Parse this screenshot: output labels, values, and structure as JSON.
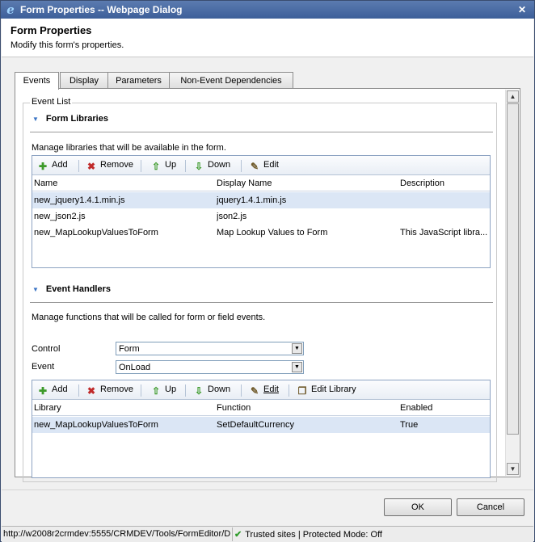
{
  "window": {
    "title": "Form Properties -- Webpage Dialog",
    "close_glyph": "✕"
  },
  "header": {
    "title": "Form Properties",
    "subtitle": "Modify this form's properties."
  },
  "tabs": [
    {
      "label": "Events",
      "active": true
    },
    {
      "label": "Display",
      "active": false
    },
    {
      "label": "Parameters",
      "active": false
    },
    {
      "label": "Non-Event Dependencies",
      "active": false
    }
  ],
  "event_list": {
    "legend": "Event List",
    "form_libraries": {
      "title": "Form Libraries",
      "description": "Manage libraries that will be available in the form.",
      "toolbar": {
        "add": "Add",
        "remove": "Remove",
        "up": "Up",
        "down": "Down",
        "edit": "Edit"
      },
      "columns": [
        "Name",
        "Display Name",
        "Description"
      ],
      "rows": [
        {
          "name": "new_jquery1.4.1.min.js",
          "display_name": "jquery1.4.1.min.js",
          "description": "",
          "selected": true
        },
        {
          "name": "new_json2.js",
          "display_name": "json2.js",
          "description": "",
          "selected": false
        },
        {
          "name": "new_MapLookupValuesToForm",
          "display_name": "Map Lookup Values to Form",
          "description": "This JavaScript libra...",
          "selected": false
        }
      ]
    },
    "event_handlers": {
      "title": "Event Handlers",
      "description": "Manage functions that will be called for form or field events.",
      "control_label": "Control",
      "control_value": "Form",
      "event_label": "Event",
      "event_value": "OnLoad",
      "toolbar": {
        "add": "Add",
        "remove": "Remove",
        "up": "Up",
        "down": "Down",
        "edit": "Edit",
        "edit_library": "Edit Library"
      },
      "columns": [
        "Library",
        "Function",
        "Enabled"
      ],
      "rows": [
        {
          "library": "new_MapLookupValuesToForm",
          "function": "SetDefaultCurrency",
          "enabled": "True",
          "selected": true
        }
      ]
    }
  },
  "footer": {
    "ok": "OK",
    "cancel": "Cancel"
  },
  "statusbar": {
    "url": "http://w2008r2crmdev:5555/CRMDEV/Tools/FormEditor/D",
    "zone": "Trusted sites | Protected Mode: Off"
  },
  "icons": {
    "ie": "internet-explorer-icon",
    "add": "add-icon",
    "remove": "remove-icon",
    "up": "up-arrow-icon",
    "down": "down-arrow-icon",
    "edit": "edit-icon",
    "edit_library": "library-icon",
    "trusted": "checkmark-icon"
  }
}
